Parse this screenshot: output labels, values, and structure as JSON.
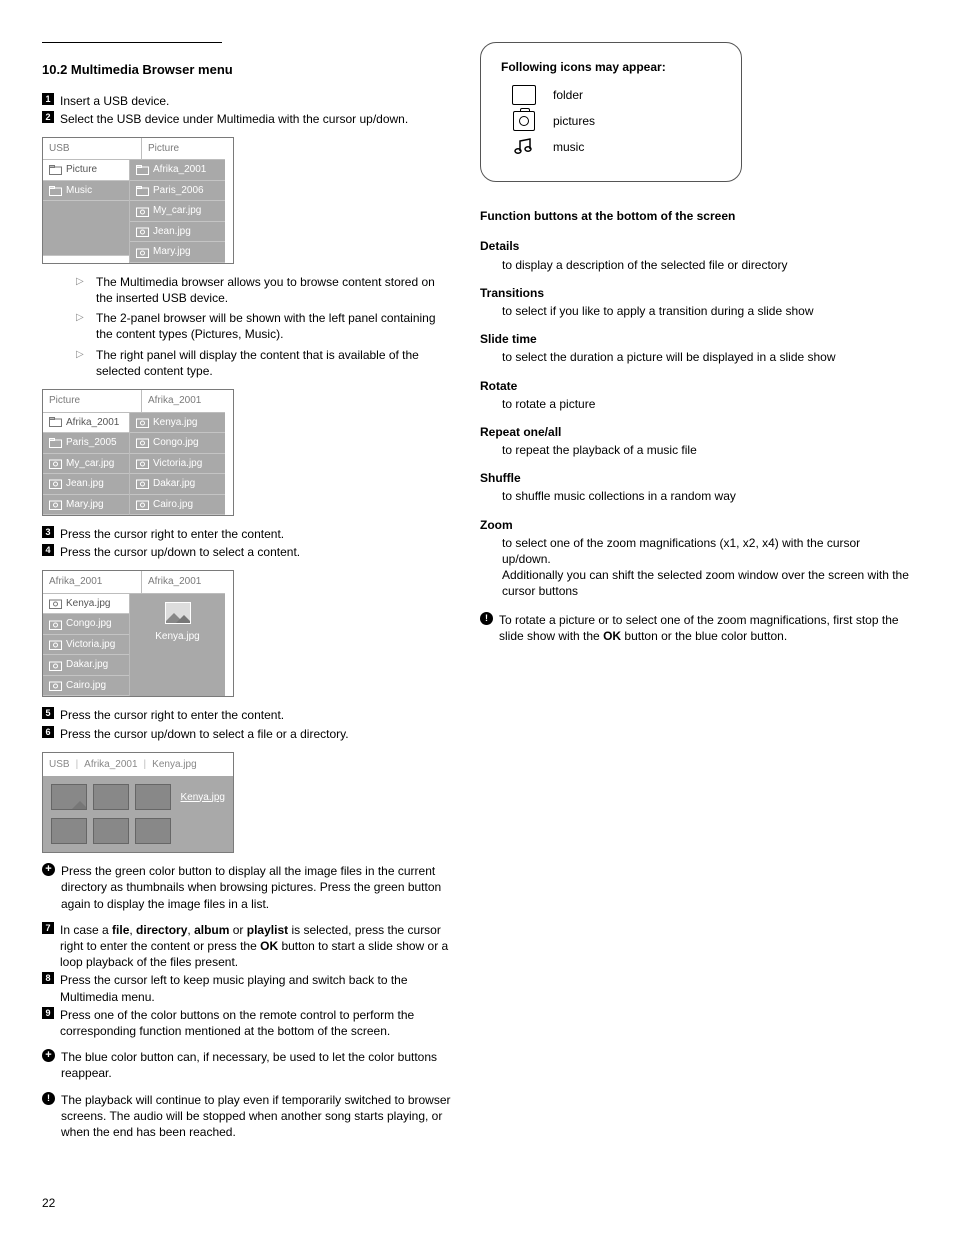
{
  "page_number": "22",
  "section_title": "10.2 Multimedia Browser menu",
  "steps": {
    "s1": "Insert a USB device.",
    "s2": "Select the USB device under Multimedia with the cursor up/down.",
    "s3": "Press the cursor right to enter the content.",
    "s4": "Press the cursor up/down to select a content.",
    "s5": "Press the cursor right to enter the content.",
    "s6": "Press the cursor up/down to select a file or a directory.",
    "s7_pre": "In case a ",
    "s7_b1": "file",
    "s7_c1": ", ",
    "s7_b2": "directory",
    "s7_c2": ", ",
    "s7_b3": "album",
    "s7_c3": " or ",
    "s7_b4": "playlist",
    "s7_post1": " is selected, press the cursor right to enter the content or press the ",
    "s7_ok": "OK",
    "s7_post2": " button to start a slide show or a loop playback of the files present.",
    "s8": "Press the cursor left to keep music playing and switch back to the Multimedia menu.",
    "s9": "Press one of the color buttons on the remote control to perform the corresponding function mentioned at the bottom of the screen."
  },
  "bullets": {
    "b1": "The Multimedia browser allows you to browse content stored on the inserted USB device.",
    "b2": "The 2-panel browser will be shown with the left panel containing the content types (Pictures, Music).",
    "b3": "The right panel will display the content that is available of the selected content type."
  },
  "notes": {
    "green": "Press the green color button to display all the image files in the current directory as thumbnails when browsing pictures. Press the green button again to display the image files in a list.",
    "blue": "The blue color button can, if necessary, be used to let the color buttons reappear.",
    "playback": "The playback will continue to play even if temporarily switched to browser screens. The audio will be stopped when another song starts playing, or when the end has been reached.",
    "rotate_pre": "To rotate a picture or to select one of the zoom magnifications, first stop the slide show with the ",
    "rotate_ok": "OK",
    "rotate_post": " button or the blue color button."
  },
  "browser1": {
    "h1": "USB",
    "h2": "Picture",
    "left": [
      "Picture",
      "Music"
    ],
    "right": [
      "Afrika_2001",
      "Paris_2006",
      "My_car.jpg",
      "Jean.jpg",
      "Mary.jpg"
    ]
  },
  "browser2": {
    "h1": "Picture",
    "h2": "Afrika_2001",
    "left": [
      "Afrika_2001",
      "Paris_2005",
      "My_car.jpg",
      "Jean.jpg",
      "Mary.jpg"
    ],
    "right": [
      "Kenya.jpg",
      "Congo.jpg",
      "Victoria.jpg",
      "Dakar.jpg",
      "Cairo.jpg"
    ]
  },
  "browser3": {
    "h1": "Afrika_2001",
    "h2": "Afrika_2001",
    "left": [
      "Kenya.jpg",
      "Congo.jpg",
      "Victoria.jpg",
      "Dakar.jpg",
      "Cairo.jpg"
    ],
    "caption": "Kenya.jpg"
  },
  "thumb": {
    "crumb": [
      "USB",
      "Afrika_2001",
      "Kenya.jpg"
    ],
    "label": "Kenya.jpg"
  },
  "iconbox": {
    "title": "Following icons may appear:",
    "items": [
      "folder",
      "pictures",
      "music"
    ]
  },
  "functions": {
    "header": "Function buttons at the bottom of the screen",
    "items": [
      {
        "t": "Details",
        "d": "to display a description of the selected file or directory"
      },
      {
        "t": "Transitions",
        "d": "to select if you like to apply a transition during a slide show"
      },
      {
        "t": "Slide time",
        "d": "to select the duration a picture will be displayed in a slide show"
      },
      {
        "t": "Rotate",
        "d": "to rotate a picture"
      },
      {
        "t": "Repeat one/all",
        "d": "to repeat the playback of a music file"
      },
      {
        "t": "Shuffle",
        "d": "to shuffle music collections in a random way"
      },
      {
        "t": "Zoom",
        "d": "to select one of the zoom magnifications (x1, x2, x4) with the cursor up/down.\nAdditionally you can shift the selected zoom window over the screen with the cursor buttons"
      }
    ]
  }
}
